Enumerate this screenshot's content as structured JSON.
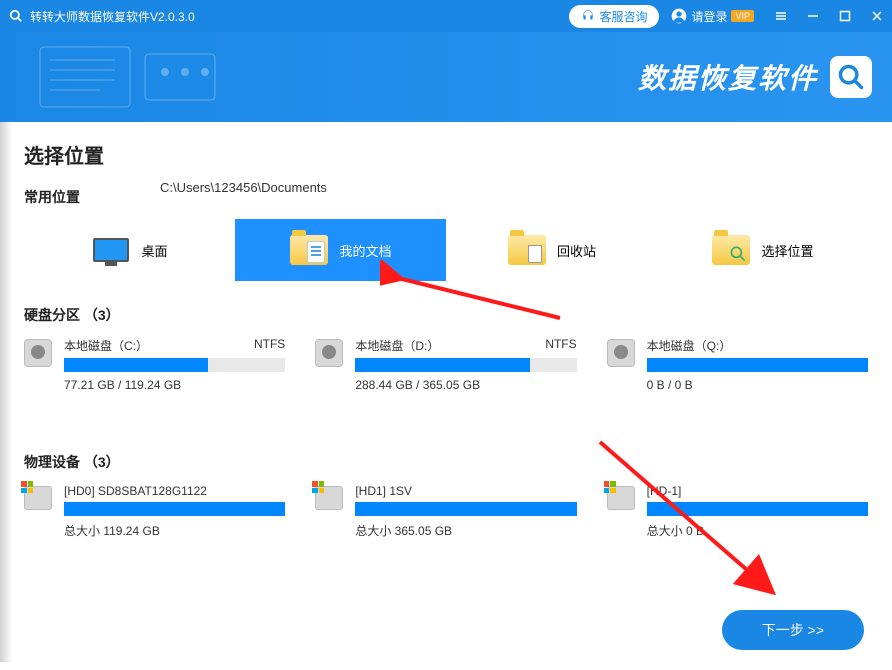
{
  "titlebar": {
    "app_title": "转转大师数据恢复软件V2.0.3.0",
    "customer_service": "客服咨询",
    "login_text": "请登录",
    "vip_badge": "VIP"
  },
  "banner": {
    "product_name": "数据恢复软件"
  },
  "section": {
    "choose_location": "选择位置",
    "common_locations": "常用位置",
    "current_path": "C:\\Users\\123456\\Documents",
    "partitions_heading": "硬盘分区 （3）",
    "physical_heading": "物理设备 （3）"
  },
  "locations": [
    {
      "label": "桌面",
      "icon": "desktop",
      "selected": false
    },
    {
      "label": "我的文档",
      "icon": "documents",
      "selected": true
    },
    {
      "label": "回收站",
      "icon": "recycle",
      "selected": false
    },
    {
      "label": "选择位置",
      "icon": "browse",
      "selected": false
    }
  ],
  "partitions": [
    {
      "name": "本地磁盘（C:）",
      "fs": "NTFS",
      "used_pct": 65,
      "size_text": "77.21 GB / 119.24 GB"
    },
    {
      "name": "本地磁盘（D:）",
      "fs": "NTFS",
      "used_pct": 79,
      "size_text": "288.44 GB / 365.05 GB"
    },
    {
      "name": "本地磁盘（Q:）",
      "fs": "",
      "used_pct": 100,
      "size_text": "0 B / 0 B"
    }
  ],
  "physical": [
    {
      "name": "[HD0] SD8SBAT128G1122",
      "size_text": "总大小 119.24 GB"
    },
    {
      "name": "[HD1] 1SV",
      "size_text": "总大小 365.05 GB"
    },
    {
      "name": "[HD-1]",
      "size_text": "总大小 0 B"
    }
  ],
  "buttons": {
    "next": "下一步 >>"
  }
}
